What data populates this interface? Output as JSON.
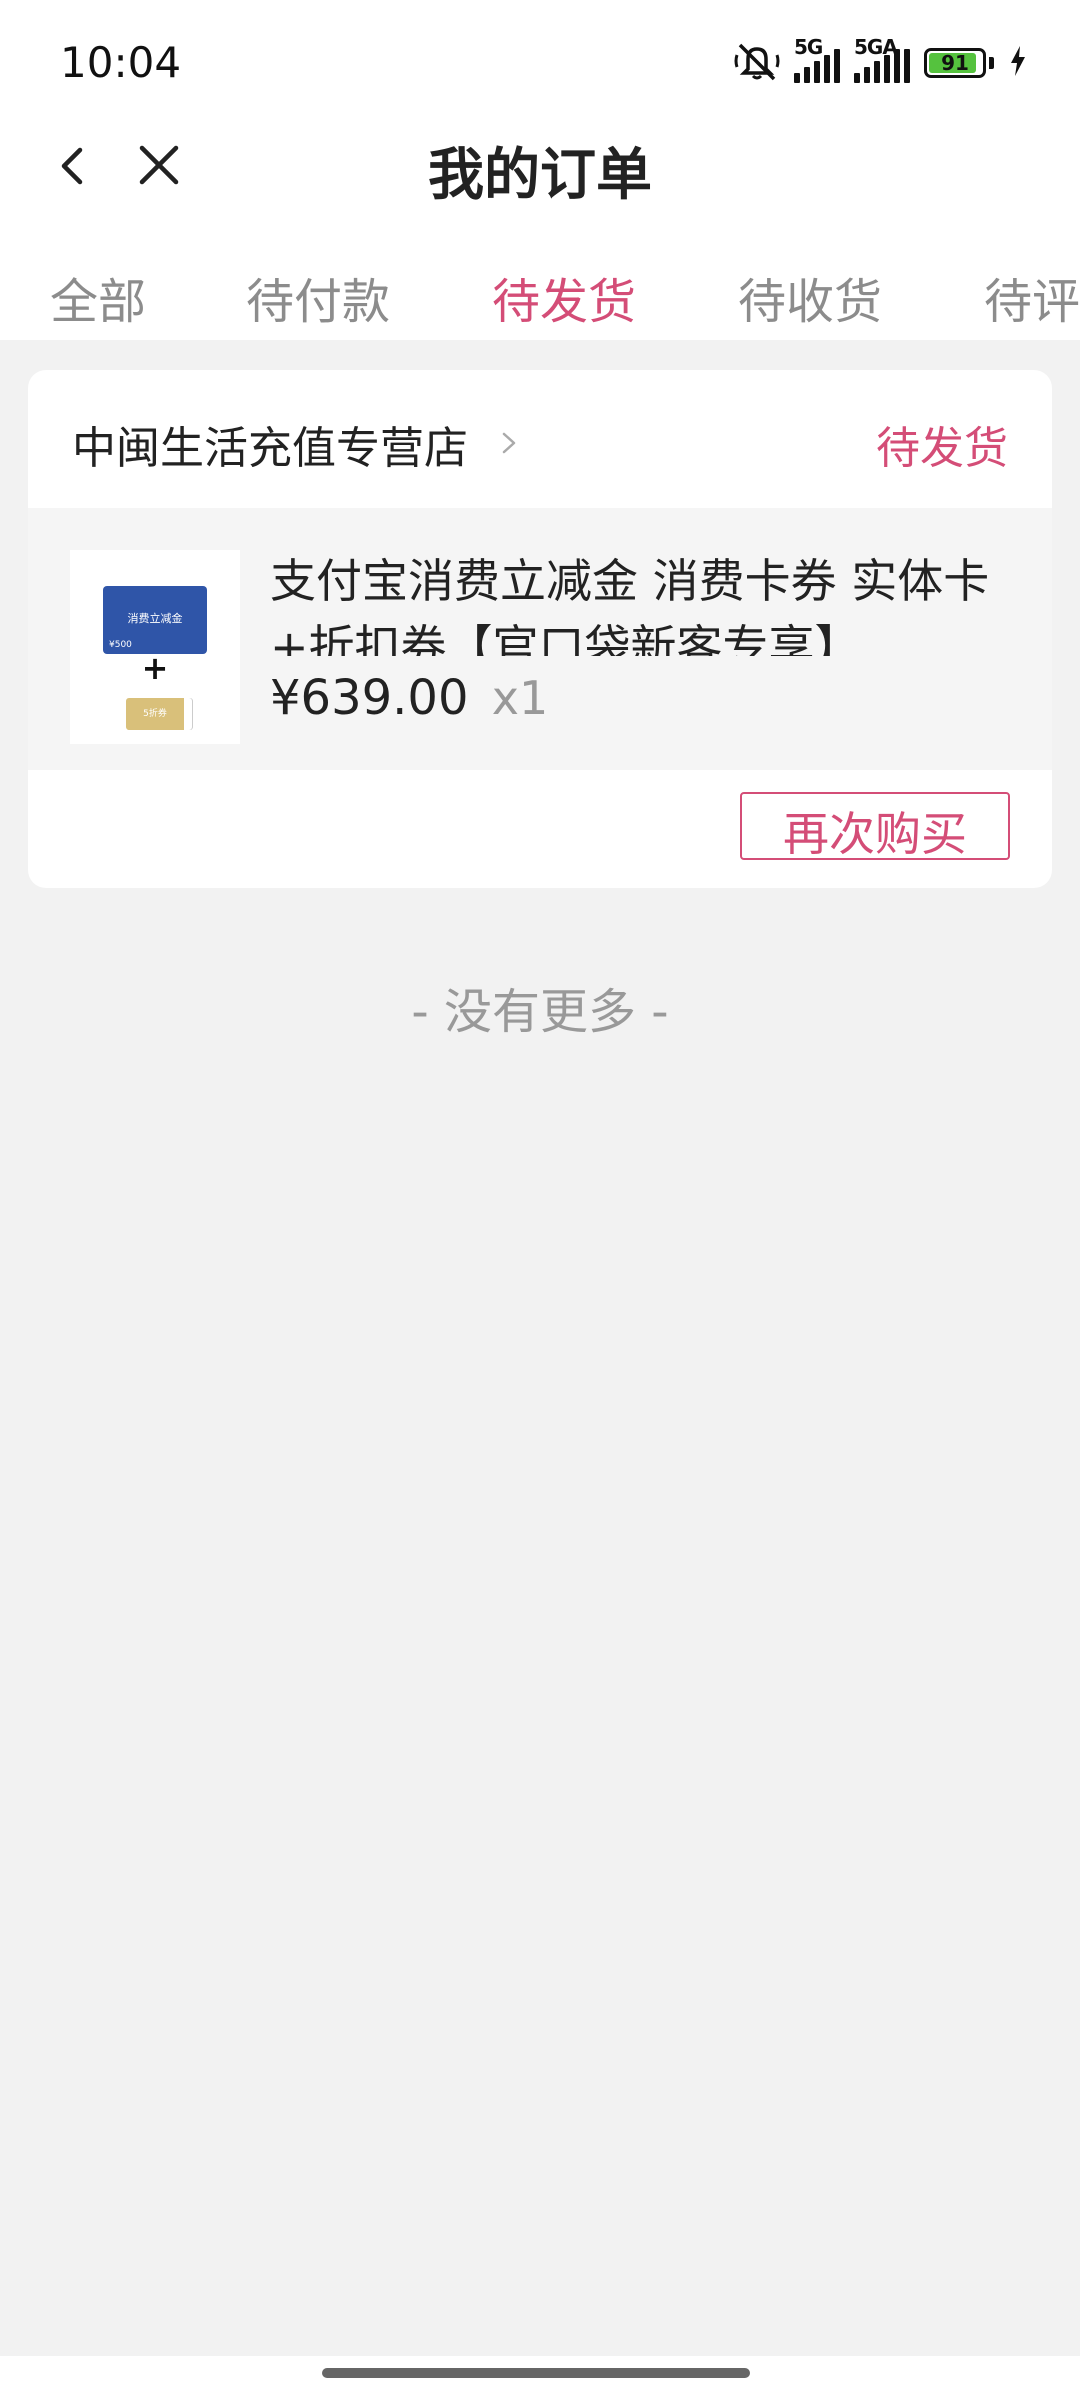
{
  "status_bar": {
    "time": "10:04",
    "network_1": "5G",
    "network_2": "5GA",
    "battery_level": 91,
    "battery_text": "91",
    "icons": [
      "mute-icon",
      "signal-icon",
      "signal-icon",
      "battery-icon",
      "charging-icon"
    ]
  },
  "nav": {
    "title": "我的订单",
    "back_icon": "chevron-left-icon",
    "close_icon": "close-icon"
  },
  "tabs": [
    {
      "label": "全部",
      "active": false
    },
    {
      "label": "待付款",
      "active": false
    },
    {
      "label": "待发货",
      "active": true
    },
    {
      "label": "待收货",
      "active": false
    },
    {
      "label": "待评",
      "active": false
    }
  ],
  "order": {
    "store_name": "中闽生活充值专营店",
    "status": "待发货",
    "product": {
      "title": "支付宝消费立减金 消费卡券 实体卡+折扣券【官口袋新客专享】",
      "price": "¥639.00",
      "quantity": "x1",
      "thumb_card_title": "消费立减金",
      "thumb_card_value": "¥500",
      "thumb_plus": "+",
      "thumb_coupon_text": "5折券"
    },
    "rebuy_label": "再次购买"
  },
  "footer": {
    "no_more": "- 没有更多 -"
  },
  "colors": {
    "accent": "#d44d77",
    "background": "#f2f2f2",
    "battery": "#55c23e"
  }
}
